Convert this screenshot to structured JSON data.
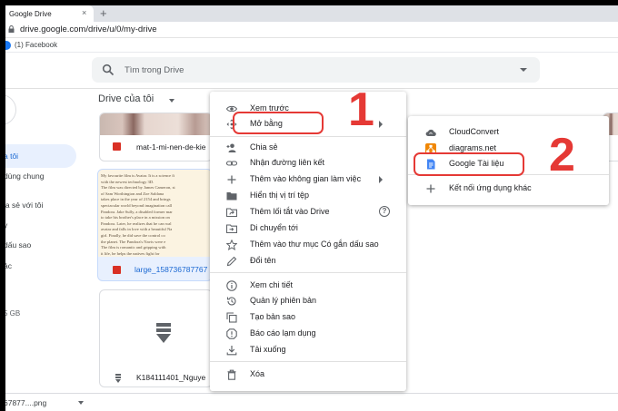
{
  "browser": {
    "tab_title": "Google Drive",
    "tab_close": "×",
    "new_tab": "+",
    "url": "drive.google.com/drive/u/0/my-drive",
    "bookmark_label": "(1) Facebook"
  },
  "drive": {
    "search_placeholder": "Tìm trong Drive",
    "breadcrumb": "Drive của tôi"
  },
  "sidebar": {
    "items": [
      {
        "label": "a tôi"
      },
      {
        "label": "dùng chung"
      },
      {
        "label": "ia sẻ với tôi"
      },
      {
        "label": "y"
      },
      {
        "label": "dấu sao"
      },
      {
        "label": "ác"
      }
    ],
    "storage": "5 GB"
  },
  "files": {
    "card1_name": "mat-1-mi-nen-de-kie",
    "card2_name": "large_158736787767",
    "card3_name": "K184111401_Nguye",
    "doc_preview_lines": [
      "My favourite film is Avatar. It is a science fi",
      "with the newest technology 3D.",
      "The film was directed by James Cameron, st",
      "of Sam Worthington and Zoe Saldana",
      "takes place in the year of 2154 and brings",
      "spectacular world beyond imagination call",
      "Pandora. Jake Sully, a disabled former mar",
      "to take his brother's place in a mission on",
      "Pandora. Later, he realizes that he can wal",
      "avatar and falls in love with a beautiful Na",
      "girl. Finally, he did save the control co",
      "the planet. The Pandora's Navis were e",
      "The film is romantic and gripping with",
      "it life, he helps the natives fight for"
    ]
  },
  "download_bar": {
    "filename": "67877....png"
  },
  "context_menu": {
    "items": [
      {
        "label": "Xem trước",
        "icon": "eye-icon"
      },
      {
        "label": "Mở bằng",
        "icon": "move-arrows-icon"
      },
      {
        "label": "Chia sẻ",
        "icon": "person-add-icon"
      },
      {
        "label": "Nhận đường liên kết",
        "icon": "link-icon"
      },
      {
        "label": "Thêm vào không gian làm việc",
        "icon": "plus-icon"
      },
      {
        "label": "Hiển thị vị trí tệp",
        "icon": "folder-icon"
      },
      {
        "label": "Thêm lối tắt vào Drive",
        "icon": "shortcut-icon"
      },
      {
        "label": "Di chuyển tới",
        "icon": "move-folder-icon"
      },
      {
        "label": "Thêm vào thư mục Có gắn dấu sao",
        "icon": "star-icon"
      },
      {
        "label": "Đổi tên",
        "icon": "pencil-icon"
      },
      {
        "label": "Xem chi tiết",
        "icon": "info-icon"
      },
      {
        "label": "Quản lý phiên bản",
        "icon": "history-icon"
      },
      {
        "label": "Tạo bản sao",
        "icon": "copy-icon"
      },
      {
        "label": "Báo cáo lạm dụng",
        "icon": "report-icon"
      },
      {
        "label": "Tải xuống",
        "icon": "download-icon"
      },
      {
        "label": "Xóa",
        "icon": "trash-icon"
      }
    ],
    "help_glyph": "?"
  },
  "submenu": {
    "items": [
      {
        "label": "CloudConvert",
        "icon": "cloud-icon"
      },
      {
        "label": "diagrams.net",
        "icon": "diagrams-icon"
      },
      {
        "label": "Google Tài liệu",
        "icon": "google-docs-icon"
      },
      {
        "label": "Kết nối ứng dụng khác",
        "icon": "plus-icon"
      }
    ]
  },
  "annotations": {
    "step1": "1",
    "step2": "2"
  },
  "colors": {
    "highlight": "#e53935",
    "active_blue": "#1967d2",
    "docs_blue": "#4285f4"
  }
}
